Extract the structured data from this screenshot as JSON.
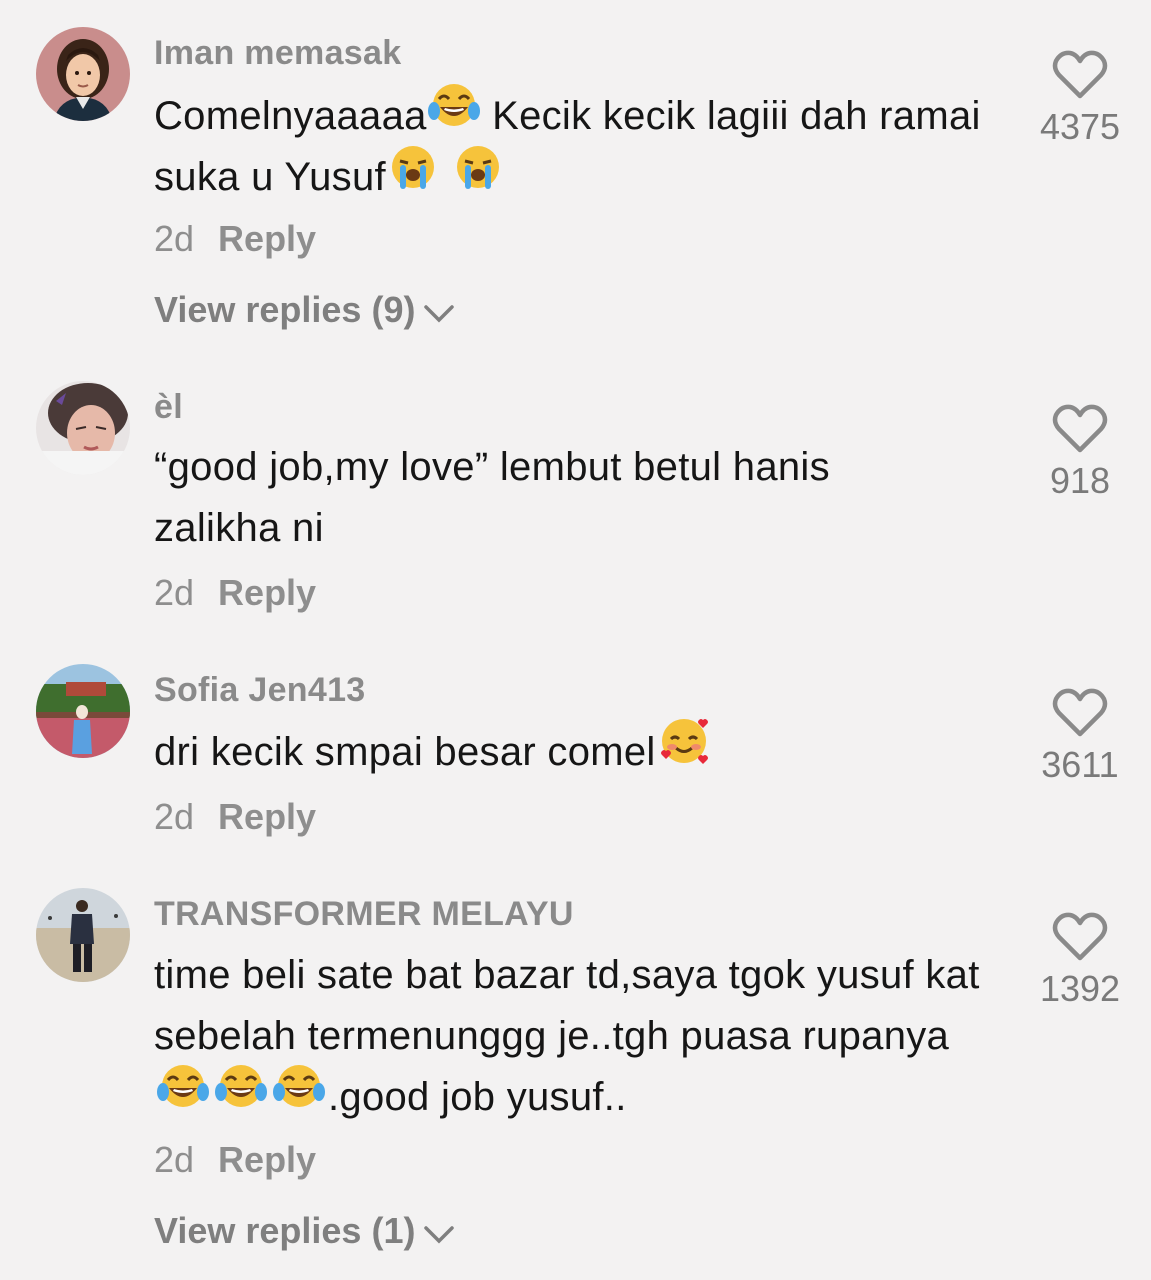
{
  "comments": [
    {
      "username": "Iman memasak",
      "avatar_icon": "cartoon-man-avatar",
      "text_parts": [
        "Comelnyaaaaa",
        "face-with-tears-of-joy",
        " Kecik kecik lagiii dah ramai suka u Yusuf",
        "loudly-crying-face",
        " ",
        "loudly-crying-face"
      ],
      "time": "2d",
      "reply": "Reply",
      "view_replies": "View replies (9)",
      "likes": "4375"
    },
    {
      "username": "èl",
      "avatar_icon": "woman-selfie-avatar",
      "text": "“good job,my love” lembut betul hanis zalikha ni",
      "time": "2d",
      "reply": "Reply",
      "likes": "918"
    },
    {
      "username": "Sofia Jen413",
      "avatar_icon": "outdoor-photo-avatar",
      "text_parts": [
        "dri kecik smpai besar comel",
        "smiling-face-with-hearts"
      ],
      "time": "2d",
      "reply": "Reply",
      "likes": "3611"
    },
    {
      "username": "TRANSFORMER MELAYU",
      "avatar_icon": "beach-man-avatar",
      "text_parts": [
        "time beli sate bat bazar td,saya tgok yusuf kat sebelah termenunggg je..tgh puasa rupanya",
        "face-with-tears-of-joy",
        "face-with-tears-of-joy",
        "face-with-tears-of-joy",
        ".good job yusuf.."
      ],
      "time": "2d",
      "reply": "Reply",
      "view_replies": "View replies (1)",
      "likes": "1392"
    }
  ],
  "colors": {
    "background": "#f3f2f2",
    "username": "#8a8a8a",
    "text": "#161616",
    "meta": "#8e8e8e"
  }
}
